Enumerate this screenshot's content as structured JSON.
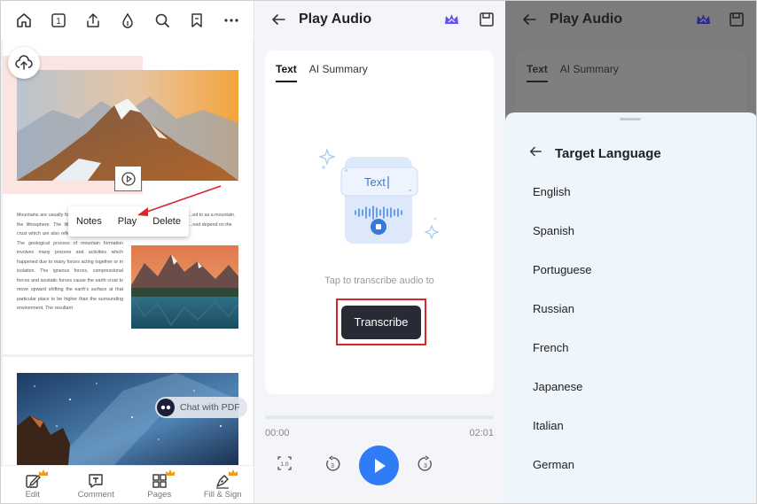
{
  "left_panel": {
    "toolbar": {
      "page_number": "1"
    },
    "context_menu": {
      "notes": "Notes",
      "play": "Play",
      "delete": "Delete"
    },
    "body_text_left": "Mountains are usually formed by the movement of the lithosphere. The lithosphere consists of the crust which are also referred to as tectonic plates. The geological process of mountain formation involves many process and activities which happened due to many forces acting together or in isolation. The igneous forces, compressional forces and isostatic forces cause the earth crust to move upward shifting the earth's surface at that particular place to be higher than the surrounding environment. The resultant",
    "body_text_right": "...ed to as a mountain. ...ned depend on the",
    "chat_pill": "Chat with PDF",
    "bottom_nav": [
      {
        "label": "Edit",
        "icon": "edit-icon",
        "premium": true
      },
      {
        "label": "Comment",
        "icon": "comment-icon",
        "premium": false
      },
      {
        "label": "Pages",
        "icon": "pages-icon",
        "premium": true
      },
      {
        "label": "Fill & Sign",
        "icon": "fill-sign-icon",
        "premium": true
      }
    ]
  },
  "middle_panel": {
    "title": "Play Audio",
    "tabs": [
      "Text",
      "AI Summary"
    ],
    "illustration_text": "Text",
    "hint": "Tap to transcribe audio to",
    "transcribe_button": "Transcribe",
    "time_current": "00:00",
    "time_total": "02:01",
    "speed_label": "1.0",
    "rewind_label": "3",
    "forward_label": "3",
    "accent_color": "#2f7cf6"
  },
  "right_panel": {
    "title": "Play Audio",
    "tabs": [
      "Text",
      "AI Summary"
    ],
    "sheet_title": "Target Language",
    "languages": [
      "English",
      "Spanish",
      "Portuguese",
      "Russian",
      "French",
      "Japanese",
      "Italian",
      "German"
    ]
  }
}
